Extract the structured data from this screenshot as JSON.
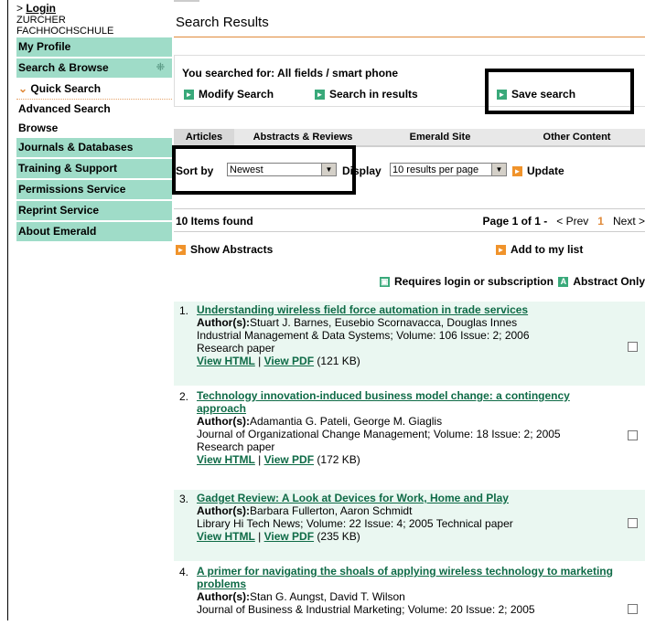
{
  "sidebar": {
    "login_prefix": "> ",
    "login": "Login",
    "institution_line1": "ZURCHER",
    "institution_line2": "FACHHOCHSCHULE",
    "items": [
      {
        "label": "My Profile"
      },
      {
        "label": "Search & Browse",
        "grip": "⁜"
      },
      {
        "label": "Quick Search",
        "chevron": "⌄"
      },
      {
        "label": "Advanced Search"
      },
      {
        "label": "Browse"
      },
      {
        "label": "Journals & Databases"
      },
      {
        "label": "Training & Support"
      },
      {
        "label": "Permissions Service"
      },
      {
        "label": "Reprint Service"
      },
      {
        "label": "About Emerald"
      }
    ]
  },
  "main": {
    "title": "Search Results",
    "searched_for": "You searched for: All fields / smart phone",
    "modify": "Modify Search",
    "search_in_results": "Search in results",
    "save_search": "Save search",
    "tabs": [
      "Articles",
      "Abstracts & Reviews",
      "Emerald Site",
      "Other Content"
    ],
    "sort_label": "Sort by",
    "sort_value": "Newest",
    "display_label": "Display",
    "display_value": "10 results per page",
    "update": "Update",
    "items_found": "10 Items found",
    "page_info": "Page 1 of 1 -",
    "prev": "< Prev",
    "current_page": "1",
    "next": "Next >",
    "show_abstracts": "Show Abstracts",
    "add_to_list": "Add to my list",
    "requires_login": "Requires login or subscription",
    "abstract_only": "Abstract Only",
    "icon_names": {
      "arrow": "arrow-right-icon",
      "lock": "lock-icon",
      "abstract": "abstract-icon"
    }
  },
  "results": [
    {
      "num": "1.",
      "title": "Understanding wireless field force automation in trade services",
      "authors_label": "Author(s):",
      "authors": "Stuart J. Barnes, Eusebio Scornavacca, Douglas Innes",
      "source": "Industrial Management & Data Systems; Volume: 106   Issue: 2; 2006",
      "type": "Research paper",
      "view_html": "View HTML",
      "sep": " | ",
      "view_pdf": "View PDF",
      "size": "(121 KB)"
    },
    {
      "num": "2.",
      "title": "Technology innovation-induced business model change: a contingency approach",
      "authors_label": "Author(s):",
      "authors": "Adamantia G. Pateli, George M. Giaglis",
      "source": "Journal of Organizational Change Management; Volume: 18   Issue: 2; 2005",
      "type": "Research paper",
      "view_html": "View HTML",
      "sep": " | ",
      "view_pdf": "View PDF",
      "size": "(172 KB)"
    },
    {
      "num": "3.",
      "title": "Gadget Review: A Look at Devices for Work, Home and Play",
      "authors_label": "Author(s):",
      "authors": "Barbara Fullerton, Aaron Schmidt",
      "source": "Library Hi Tech News; Volume: 22   Issue: 4; 2005 Technical paper",
      "type": "",
      "view_html": "View HTML",
      "sep": " | ",
      "view_pdf": "View PDF",
      "size": "(235 KB)"
    },
    {
      "num": "4.",
      "title": "A primer for navigating the shoals of applying wireless technology to marketing problems",
      "authors_label": "Author(s):",
      "authors": "Stan G. Aungst, David T. Wilson",
      "source": "Journal of Business & Industrial Marketing; Volume: 20   Issue: 2; 2005",
      "type": "",
      "view_html": "",
      "sep": "",
      "view_pdf": "",
      "size": ""
    }
  ],
  "colors": {
    "accent": "#e08a3a",
    "nav": "#9fdcc8",
    "link": "#0f6b47",
    "icon_green": "#39a97a",
    "icon_orange": "#f0932b"
  }
}
